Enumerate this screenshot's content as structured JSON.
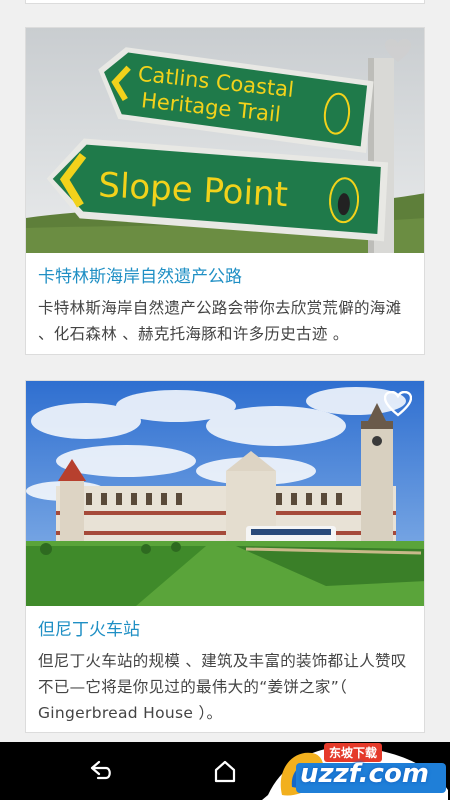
{
  "cards": [
    {
      "title": "卡特林斯海岸自然遗产公路",
      "description": "卡特林斯海岸自然遗产公路会带你去欣赏荒僻的海滩 、化石森林 、赫克托海豚和许多历史古迹 。",
      "sign_upper_line1": "Catlins Coastal",
      "sign_upper_line2": "Heritage Trail",
      "sign_lower": "Slope Point"
    },
    {
      "title": "但尼丁火车站",
      "description": "但尼丁火车站的规模 、建筑及丰富的装饰都让人赞叹不已—它将是你见过的最伟大的“姜饼之家”（ Gingerbread House ）。"
    }
  ],
  "watermark": {
    "top_text": "东坡下载",
    "main_text": "uzzf.com"
  },
  "colors": {
    "title": "#1f8fc4",
    "sign_green": "#1f7a4a",
    "sign_text": "#f2d21b",
    "navbar": "#000000"
  },
  "icons": [
    "heart-icon",
    "back-icon",
    "home-icon"
  ]
}
